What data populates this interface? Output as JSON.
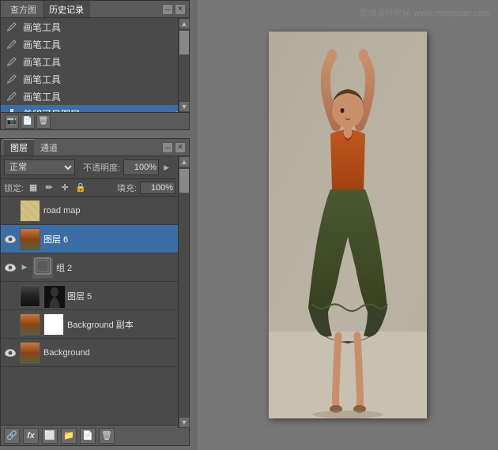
{
  "watermark": {
    "text": "思缘设计论坛 www.missyuan.com"
  },
  "history_panel": {
    "tab1_label": "查方图",
    "tab2_label": "历史记录",
    "items": [
      {
        "label": "画笔工具",
        "active": false
      },
      {
        "label": "画笔工具",
        "active": false
      },
      {
        "label": "画笔工具",
        "active": false
      },
      {
        "label": "画笔工具",
        "active": false
      },
      {
        "label": "画笔工具",
        "active": false
      },
      {
        "label": "盖印可见图层",
        "active": true
      }
    ]
  },
  "layers_panel": {
    "tab1_label": "图层",
    "tab2_label": "通道",
    "blend_mode": "正常",
    "opacity_label": "不透明度:",
    "opacity_value": "100%",
    "lock_label": "锁定:",
    "fill_label": "填充:",
    "fill_value": "100%",
    "layers": [
      {
        "name": "road map",
        "visible": false,
        "active": false,
        "has_mask": false,
        "locked": false,
        "type": "road_map"
      },
      {
        "name": "图层 6",
        "visible": true,
        "active": true,
        "has_mask": false,
        "locked": false,
        "type": "layer6"
      },
      {
        "name": "组 2",
        "visible": true,
        "active": false,
        "has_mask": false,
        "locked": false,
        "type": "group",
        "is_group": true
      },
      {
        "name": "图层 5",
        "visible": false,
        "active": false,
        "has_mask": true,
        "locked": false,
        "type": "layer5"
      },
      {
        "name": "Background 副本",
        "visible": false,
        "active": false,
        "has_mask": true,
        "locked": false,
        "type": "bg_copy"
      },
      {
        "name": "Background",
        "visible": true,
        "active": false,
        "has_mask": false,
        "locked": true,
        "type": "background"
      }
    ],
    "bottom_buttons": [
      "link",
      "fx",
      "mask",
      "group",
      "new",
      "trash"
    ]
  }
}
